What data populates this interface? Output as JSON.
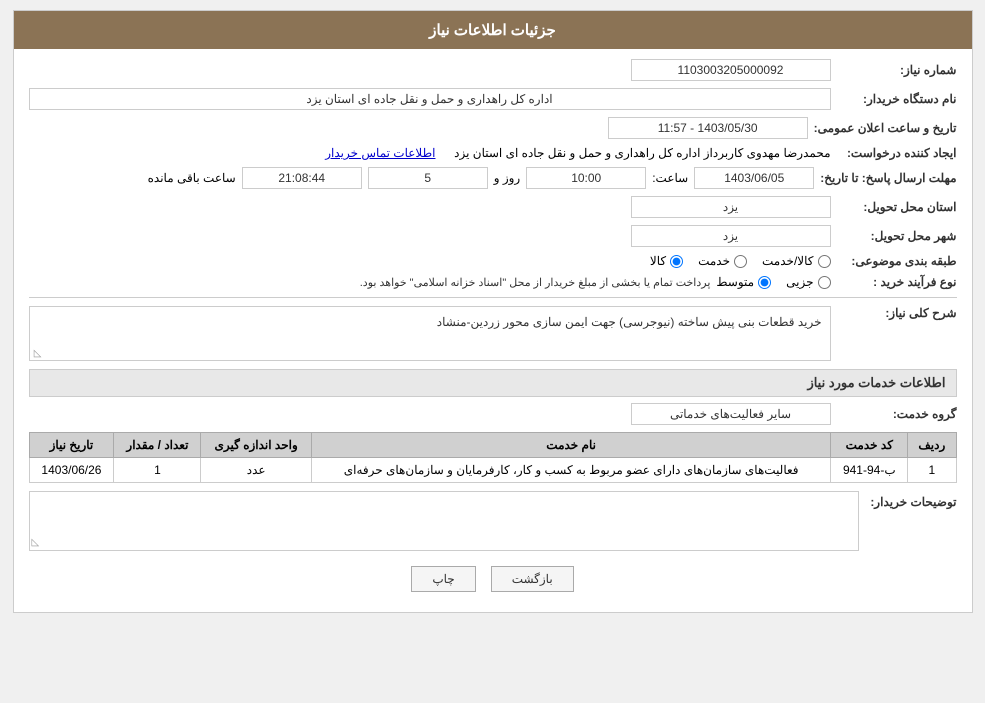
{
  "header": {
    "title": "جزئیات اطلاعات نیاز"
  },
  "fields": {
    "need_number_label": "شماره نیاز:",
    "need_number_value": "1103003205000092",
    "organization_label": "نام دستگاه خریدار:",
    "organization_value": "اداره کل راهداری و حمل و نقل جاده ای استان یزد",
    "announcement_label": "تاریخ و ساعت اعلان عمومی:",
    "announcement_value": "1403/05/30 - 11:57",
    "creator_label": "ایجاد کننده درخواست:",
    "creator_value": "محمدرضا مهدوی کاربرداز اداره کل راهداری و حمل و نقل جاده ای استان یزد",
    "contact_link": "اطلاعات تماس خریدار",
    "deadline_label": "مهلت ارسال پاسخ: تا تاریخ:",
    "deadline_date": "1403/06/05",
    "deadline_time_label": "ساعت:",
    "deadline_time": "10:00",
    "deadline_days_label": "روز و",
    "deadline_days": "5",
    "deadline_remaining_label": "ساعت باقی مانده",
    "deadline_remaining": "21:08:44",
    "province_label": "استان محل تحویل:",
    "province_value": "یزد",
    "city_label": "شهر محل تحویل:",
    "city_value": "یزد",
    "category_label": "طبقه بندی موضوعی:",
    "category_options": [
      "کالا",
      "خدمت",
      "کالا/خدمت"
    ],
    "category_selected": "کالا",
    "purchase_type_label": "نوع فرآیند خرید :",
    "purchase_type_options": [
      "جزیی",
      "متوسط"
    ],
    "purchase_type_selected": "متوسط",
    "purchase_type_note": "پرداخت تمام یا بخشی از مبلغ خریدار از محل \"اسناد خزانه اسلامی\" خواهد بود.",
    "need_description_label": "شرح کلی نیاز:",
    "need_description_value": "خرید قطعات بنی پیش ساخته (نیوجرسی) جهت ایمن سازی محور زردین-منشاد",
    "services_section_title": "اطلاعات خدمات مورد نیاز",
    "service_group_label": "گروه خدمت:",
    "service_group_value": "سایر فعالیت‌های خدماتی",
    "table": {
      "headers": [
        "ردیف",
        "کد خدمت",
        "نام خدمت",
        "واحد اندازه گیری",
        "تعداد / مقدار",
        "تاریخ نیاز"
      ],
      "rows": [
        {
          "row": "1",
          "code": "ب-94-941",
          "name": "فعالیت‌های سازمان‌های دارای عضو مربوط به کسب و کار، کارفرمایان و سازمان‌های حرفه‌ای",
          "unit": "عدد",
          "quantity": "1",
          "date": "1403/06/26"
        }
      ]
    },
    "buyer_notes_label": "توضیحات خریدار:",
    "buyer_notes_value": ""
  },
  "buttons": {
    "print_label": "چاپ",
    "back_label": "بازگشت"
  }
}
